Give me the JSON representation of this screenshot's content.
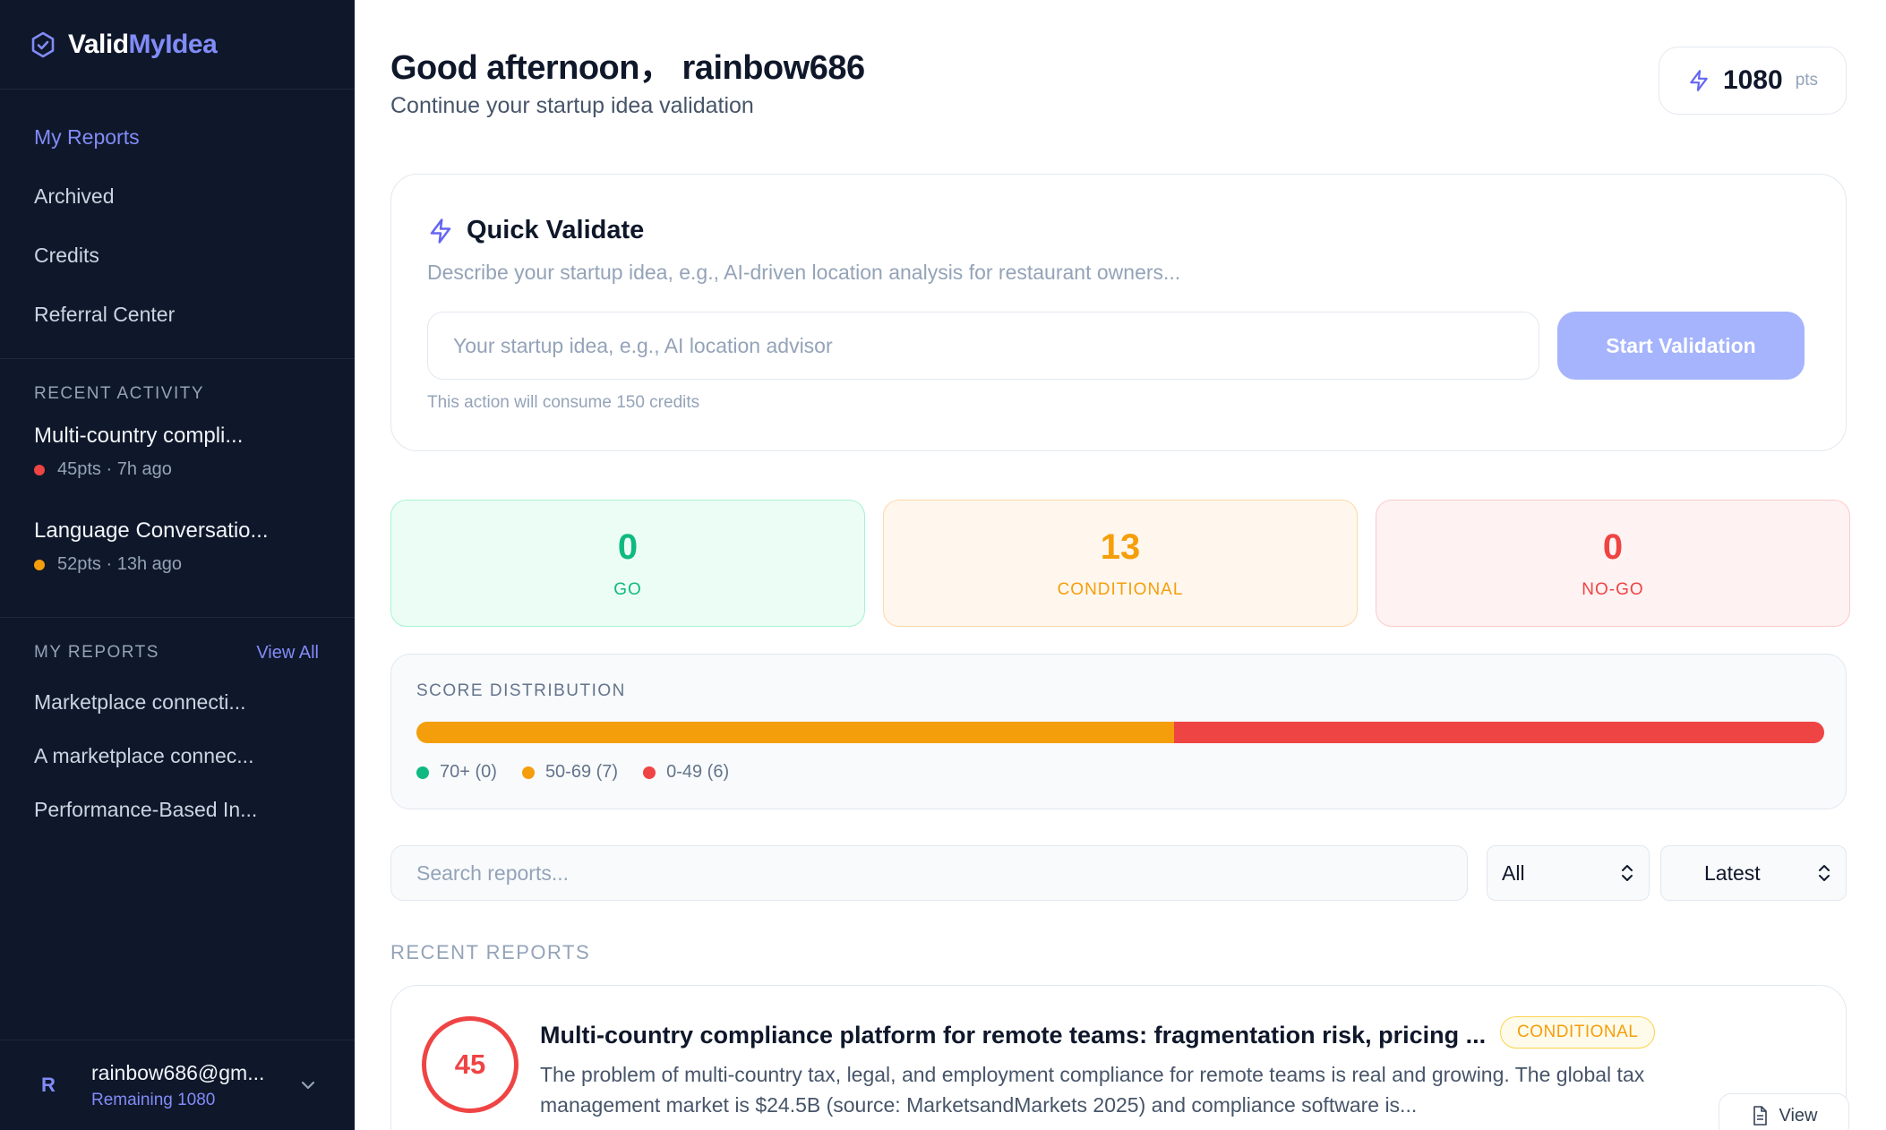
{
  "brand": {
    "part1": "Valid",
    "part2": "MyIdea"
  },
  "nav": [
    {
      "label": "My Reports",
      "active": true
    },
    {
      "label": "Archived",
      "active": false
    },
    {
      "label": "Credits",
      "active": false
    },
    {
      "label": "Referral Center",
      "active": false
    }
  ],
  "recent_activity": {
    "title": "RECENT ACTIVITY",
    "items": [
      {
        "title": "Multi-country compli...",
        "meta": "45pts · 7h ago",
        "dot_color": "#ef4444"
      },
      {
        "title": "Language Conversatio...",
        "meta": "52pts · 13h ago",
        "dot_color": "#f59e0b"
      }
    ]
  },
  "my_reports": {
    "title": "MY REPORTS",
    "view_all": "View All",
    "items": [
      "Marketplace connecti...",
      "A marketplace connec...",
      "Performance-Based In..."
    ]
  },
  "user": {
    "initial": "R",
    "email": "rainbow686@gm...",
    "remaining": "Remaining 1080"
  },
  "header": {
    "greeting": "Good afternoon， rainbow686",
    "subtitle": "Continue your startup idea validation",
    "points": "1080",
    "points_unit": "pts"
  },
  "quick_validate": {
    "title": "Quick Validate",
    "description": "Describe your startup idea, e.g., AI-driven location analysis for restaurant owners...",
    "input_placeholder": "Your startup idea, e.g., AI location advisor",
    "input_value": "",
    "button": "Start Validation",
    "note": "This action will consume 150 credits"
  },
  "stats": {
    "go": {
      "value": "0",
      "label": "GO"
    },
    "conditional": {
      "value": "13",
      "label": "CONDITIONAL"
    },
    "nogo": {
      "value": "0",
      "label": "NO-GO"
    }
  },
  "distribution": {
    "title": "SCORE DISTRIBUTION",
    "segments": [
      {
        "label": "70+ (0)",
        "count": 0,
        "color": "#10b981"
      },
      {
        "label": "50-69 (7)",
        "count": 7,
        "color": "#f59e0b"
      },
      {
        "label": "0-49 (6)",
        "count": 6,
        "color": "#ef4444"
      }
    ]
  },
  "filters": {
    "search_placeholder": "Search reports...",
    "search_value": "",
    "status": "All",
    "sort": "Latest"
  },
  "recent_reports": {
    "title": "RECENT REPORTS",
    "items": [
      {
        "score": "45",
        "title": "Multi-country compliance platform for remote teams: fragmentation risk, pricing ...",
        "badge": "CONDITIONAL",
        "description": "The problem of multi-country tax, legal, and employment compliance for remote teams is real and growing. The global tax management market is $24.5B (source: MarketsandMarkets 2025) and compliance software is...",
        "view": "View"
      }
    ]
  },
  "colors": {
    "accent": "#818cf8",
    "sidebar_bg": "#0f172a",
    "go": "#10b981",
    "conditional": "#f59e0b",
    "nogo": "#ef4444"
  }
}
